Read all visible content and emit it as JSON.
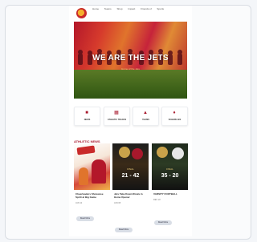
{
  "nav": {
    "links": [
      "Home",
      "Teams",
      "Shop",
      "Impact",
      "Friends of",
      "Sports"
    ]
  },
  "hero": {
    "title": "WE ARE THE JETS",
    "subtitle": "Home of the Jets"
  },
  "quick_links": [
    {
      "label": "NEWS",
      "icon": "newspaper-icon"
    },
    {
      "label": "ATHLETIC TRACKS",
      "icon": "calendar-icon"
    },
    {
      "label": "TEAMS",
      "icon": "shirt-icon"
    },
    {
      "label": "SCHEDULES",
      "icon": "trophy-icon"
    }
  ],
  "featured": {
    "title": "ATHLETIC NEWS",
    "articles": [
      {
        "headline": "Cheerleaders Showcase Spirit at Big Game",
        "meta": "JAN 12",
        "excerpt": "",
        "button": "Read More"
      },
      {
        "headline": "Jets Take Down Rivals in Home Opener",
        "meta": "JAN 08",
        "excerpt": "",
        "button": "Read More",
        "score": "21 - 42",
        "score_label": "FINAL"
      },
      {
        "headline": "VARSITY FOOTBALL",
        "meta": "DEC 22",
        "excerpt": "",
        "button": "Read More",
        "score": "35 - 20",
        "score_label": "FINAL"
      }
    ]
  },
  "colors": {
    "brand": "#a8182c",
    "accent": "#f2d27a"
  }
}
